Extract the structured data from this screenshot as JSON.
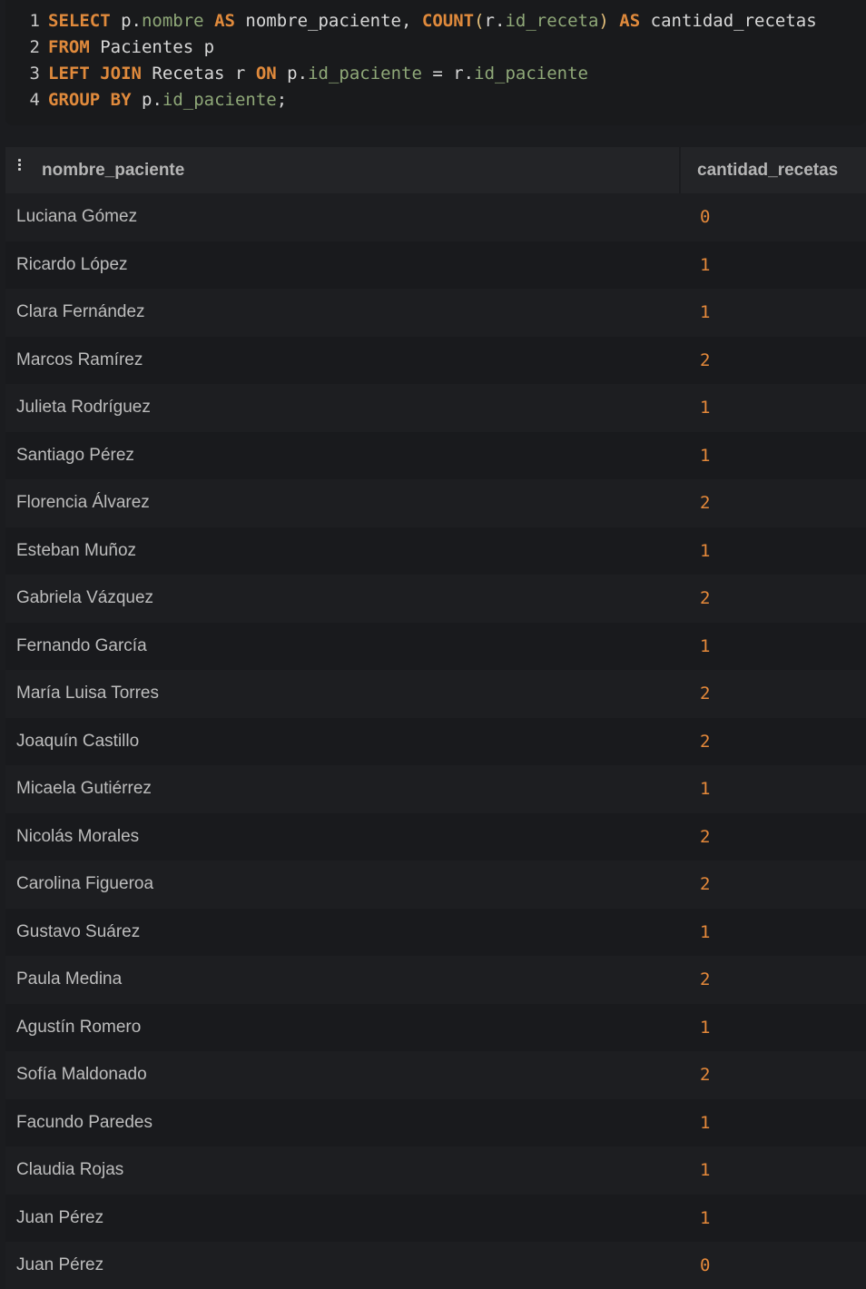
{
  "editor": {
    "lines": [
      {
        "num": "1",
        "tokens": [
          {
            "t": "SELECT",
            "c": "kw"
          },
          {
            "t": " p",
            "c": "plain"
          },
          {
            "t": ".",
            "c": "plain"
          },
          {
            "t": "nombre",
            "c": "col"
          },
          {
            "t": " ",
            "c": "plain"
          },
          {
            "t": "AS",
            "c": "kw"
          },
          {
            "t": " nombre_paciente, ",
            "c": "plain"
          },
          {
            "t": "COUNT",
            "c": "kw"
          },
          {
            "t": "(",
            "c": "paren"
          },
          {
            "t": "r",
            "c": "plain"
          },
          {
            "t": ".",
            "c": "plain"
          },
          {
            "t": "id_receta",
            "c": "col"
          },
          {
            "t": ")",
            "c": "paren"
          },
          {
            "t": " ",
            "c": "plain"
          },
          {
            "t": "AS",
            "c": "kw"
          },
          {
            "t": " cantidad_recetas",
            "c": "plain"
          }
        ]
      },
      {
        "num": "2",
        "tokens": [
          {
            "t": "FROM",
            "c": "kw"
          },
          {
            "t": " Pacientes p",
            "c": "plain"
          }
        ]
      },
      {
        "num": "3",
        "tokens": [
          {
            "t": "LEFT",
            "c": "kw"
          },
          {
            "t": " ",
            "c": "plain"
          },
          {
            "t": "JOIN",
            "c": "kw"
          },
          {
            "t": " Recetas r ",
            "c": "plain"
          },
          {
            "t": "ON",
            "c": "kw"
          },
          {
            "t": " p",
            "c": "plain"
          },
          {
            "t": ".",
            "c": "plain"
          },
          {
            "t": "id_paciente",
            "c": "col"
          },
          {
            "t": " = r",
            "c": "plain"
          },
          {
            "t": ".",
            "c": "plain"
          },
          {
            "t": "id_paciente",
            "c": "col"
          }
        ]
      },
      {
        "num": "4",
        "tokens": [
          {
            "t": "GROUP",
            "c": "kw"
          },
          {
            "t": " ",
            "c": "plain"
          },
          {
            "t": "BY",
            "c": "kw"
          },
          {
            "t": " p",
            "c": "plain"
          },
          {
            "t": ".",
            "c": "plain"
          },
          {
            "t": "id_paciente",
            "c": "col"
          },
          {
            "t": ";",
            "c": "plain"
          }
        ]
      }
    ]
  },
  "results": {
    "columns": [
      "nombre_paciente",
      "cantidad_recetas"
    ],
    "menu_icon": "column-menu-icon",
    "rows": [
      [
        "Luciana Gómez",
        "0"
      ],
      [
        "Ricardo López",
        "1"
      ],
      [
        "Clara Fernández",
        "1"
      ],
      [
        "Marcos Ramírez",
        "2"
      ],
      [
        "Julieta Rodríguez",
        "1"
      ],
      [
        "Santiago Pérez",
        "1"
      ],
      [
        "Florencia Álvarez",
        "2"
      ],
      [
        "Esteban Muñoz",
        "1"
      ],
      [
        "Gabriela Vázquez",
        "2"
      ],
      [
        "Fernando García",
        "1"
      ],
      [
        "María Luisa Torres",
        "2"
      ],
      [
        "Joaquín Castillo",
        "2"
      ],
      [
        "Micaela Gutiérrez",
        "1"
      ],
      [
        "Nicolás Morales",
        "2"
      ],
      [
        "Carolina Figueroa",
        "2"
      ],
      [
        "Gustavo Suárez",
        "1"
      ],
      [
        "Paula Medina",
        "2"
      ],
      [
        "Agustín Romero",
        "1"
      ],
      [
        "Sofía Maldonado",
        "2"
      ],
      [
        "Facundo Paredes",
        "1"
      ],
      [
        "Claudia Rojas",
        "1"
      ],
      [
        "Juan Pérez",
        "1"
      ],
      [
        "Juan Pérez",
        "0"
      ]
    ]
  },
  "colors": {
    "keyword": "#e08a3c",
    "column_ref": "#8fa878",
    "number": "#e5893a",
    "background": "#1b1c1f"
  }
}
